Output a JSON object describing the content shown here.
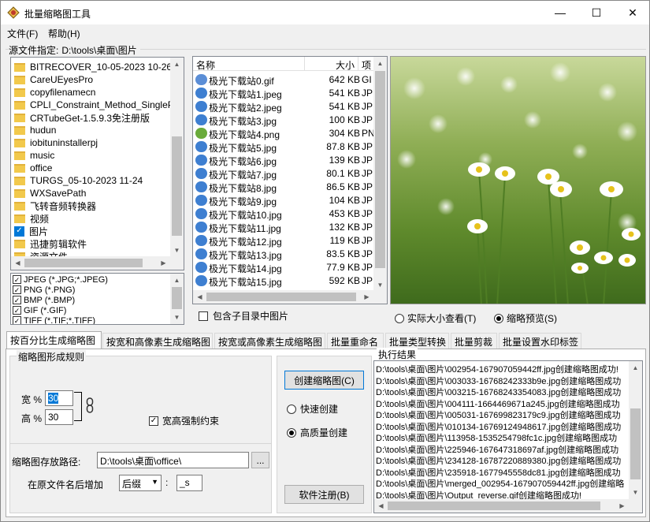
{
  "window": {
    "title": "批量缩略图工具",
    "minimize": "—",
    "maximize": "☐",
    "close": "✕"
  },
  "menu": {
    "file": "文件(F)",
    "help": "帮助(H)"
  },
  "source": {
    "label": "源文件指定:",
    "path": "D:\\tools\\桌面\\图片"
  },
  "folders": [
    {
      "name": "BITRECOVER_10-05-2023 10-26"
    },
    {
      "name": "CareUEyesPro"
    },
    {
      "name": "copyfilenamecn"
    },
    {
      "name": "CPLI_Constraint_Method_SinglePage"
    },
    {
      "name": "CRTubeGet-1.5.9.3免注册版"
    },
    {
      "name": "hudun"
    },
    {
      "name": "iobituninstallerpj"
    },
    {
      "name": "music"
    },
    {
      "name": "office"
    },
    {
      "name": "TURGS_05-10-2023 11-24"
    },
    {
      "name": "WXSavePath"
    },
    {
      "name": "飞转音频转换器"
    },
    {
      "name": "视频"
    },
    {
      "name": "图片",
      "checked": true
    },
    {
      "name": "迅捷剪辑软件"
    },
    {
      "name": "资源文件"
    }
  ],
  "filetypes": [
    {
      "label": "JPEG (*.JPG;*.JPEG)",
      "checked": true
    },
    {
      "label": "PNG (*.PNG)",
      "checked": true
    },
    {
      "label": "BMP (*.BMP)",
      "checked": true
    },
    {
      "label": "GIF (*.GIF)",
      "checked": true
    },
    {
      "label": "TIFF (*.TIF;*.TIFF)",
      "checked": true
    }
  ],
  "filelist": {
    "columns": {
      "name": "名称",
      "size": "大小",
      "type": "项"
    },
    "rows": [
      {
        "icon": "gif",
        "name": "极光下载站0.gif",
        "size": "642 KB",
        "type": "GI"
      },
      {
        "icon": "jpg",
        "name": "极光下载站1.jpeg",
        "size": "541 KB",
        "type": "JP"
      },
      {
        "icon": "jpg",
        "name": "极光下载站2.jpeg",
        "size": "541 KB",
        "type": "JP"
      },
      {
        "icon": "jpg",
        "name": "极光下载站3.jpg",
        "size": "100 KB",
        "type": "JP"
      },
      {
        "icon": "png",
        "name": "极光下载站4.png",
        "size": "304 KB",
        "type": "PN"
      },
      {
        "icon": "jpg",
        "name": "极光下载站5.jpg",
        "size": "87.8 KB",
        "type": "JP"
      },
      {
        "icon": "jpg",
        "name": "极光下载站6.jpg",
        "size": "139 KB",
        "type": "JP"
      },
      {
        "icon": "jpg",
        "name": "极光下载站7.jpg",
        "size": "80.1 KB",
        "type": "JP"
      },
      {
        "icon": "jpg",
        "name": "极光下载站8.jpg",
        "size": "86.5 KB",
        "type": "JP"
      },
      {
        "icon": "jpg",
        "name": "极光下载站9.jpg",
        "size": "104 KB",
        "type": "JP"
      },
      {
        "icon": "jpg",
        "name": "极光下载站10.jpg",
        "size": "453 KB",
        "type": "JP"
      },
      {
        "icon": "jpg",
        "name": "极光下载站11.jpg",
        "size": "132 KB",
        "type": "JP"
      },
      {
        "icon": "jpg",
        "name": "极光下载站12.jpg",
        "size": "119 KB",
        "type": "JP"
      },
      {
        "icon": "jpg",
        "name": "极光下载站13.jpg",
        "size": "83.5 KB",
        "type": "JP"
      },
      {
        "icon": "jpg",
        "name": "极光下载站14.jpg",
        "size": "77.9 KB",
        "type": "JP"
      },
      {
        "icon": "jpg",
        "name": "极光下载站15.jpg",
        "size": "592 KB",
        "type": "JP"
      }
    ]
  },
  "include_subdirs": "包含子目录中图片",
  "preview_modes": {
    "actual": "实际大小查看(T)",
    "thumb": "缩略预览(S)"
  },
  "tabs": [
    "按百分比生成缩略图",
    "按宽和高像素生成缩略图",
    "按宽或高像素生成缩略图",
    "批量重命名",
    "批量类型转换",
    "批量剪裁",
    "批量设置水印标签"
  ],
  "rules": {
    "group_label": "缩略图形成规则",
    "width_label": "宽 %",
    "width_value": "30",
    "height_label": "高 %",
    "height_value": "30",
    "constrain": "宽高强制约束",
    "save_label": "缩略图存放路径:",
    "save_path": "D:\\tools\\桌面\\office\\",
    "browse": "...",
    "suffix_label": "在原文件名后增加",
    "suffix_mode": "后缀",
    "suffix_colon": ":",
    "suffix_value": "_s"
  },
  "actions": {
    "create": "创建缩略图(C)",
    "fast": "快速创建",
    "hq": "高质量创建",
    "register": "软件注册(B)"
  },
  "log": {
    "label": "执行结果",
    "lines": [
      "D:\\tools\\桌面\\图片\\002954-167907059442ff.jpg创建缩略图成功!",
      "D:\\tools\\桌面\\图片\\003033-16768242333b9e.jpg创建缩略图成功",
      "D:\\tools\\桌面\\图片\\003215-16768243354083.jpg创建缩略图成功",
      "D:\\tools\\桌面\\图片\\004111-1664469671a245.jpg创建缩略图成功",
      "D:\\tools\\桌面\\图片\\005031-167699823179c9.jpg创建缩略图成功",
      "D:\\tools\\桌面\\图片\\010134-16769124948617.jpg创建缩略图成功",
      "D:\\tools\\桌面\\图片\\113958-1535254798fc1c.jpg创建缩略图成功",
      "D:\\tools\\桌面\\图片\\225946-167647318697af.jpg创建缩略图成功",
      "D:\\tools\\桌面\\图片\\234128-16787220889380.jpg创建缩略图成功",
      "D:\\tools\\桌面\\图片\\235918-1677945558dc81.jpg创建缩略图成功",
      "D:\\tools\\桌面\\图片\\merged_002954-167907059442ff.jpg创建缩略",
      "D:\\tools\\桌面\\图片\\Output_reverse.gif创建缩略图成功!"
    ]
  },
  "colors": {
    "accent": "#0078d7",
    "selection": "#0078d7",
    "gif": "#5b8ed6",
    "jpg": "#3e7fd1",
    "png": "#6aab3b"
  }
}
